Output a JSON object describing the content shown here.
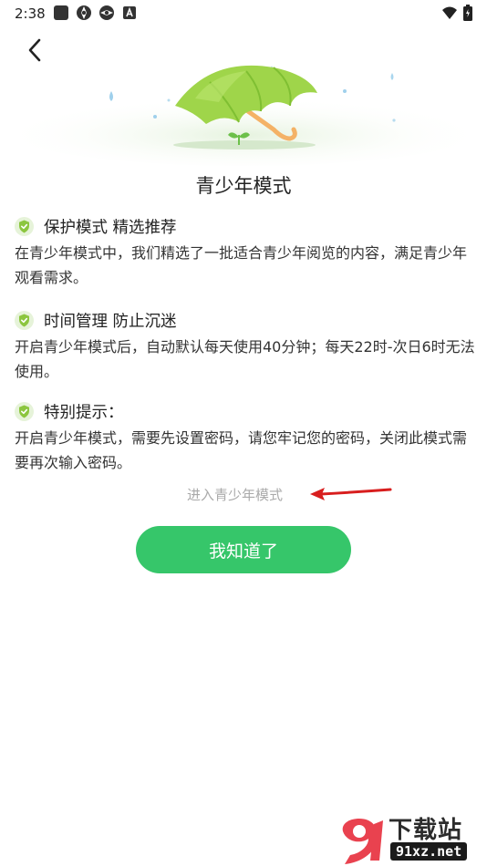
{
  "status_bar": {
    "time": "2:38"
  },
  "header": {
    "back_icon": "chevron-left-icon"
  },
  "page": {
    "title": "青少年模式"
  },
  "sections": [
    {
      "heading": "保护模式 精选推荐",
      "body": "在青少年模式中，我们精选了一批适合青少年阅览的内容，满足青少年观看需求。"
    },
    {
      "heading": "时间管理 防止沉迷",
      "body": "开启青少年模式后，自动默认每天使用40分钟；每天22时-次日6时无法使用。"
    },
    {
      "heading": "特别提示：",
      "body": "开启青少年模式，需要先设置密码，请您牢记您的密码，关闭此模式需要再次输入密码。"
    }
  ],
  "actions": {
    "enter_link": "进入青少年模式",
    "confirm_button": "我知道了"
  },
  "watermark": {
    "title": "下载站",
    "url": "91xz.net"
  },
  "colors": {
    "accent_green": "#36c66a",
    "shield_green": "#8cc63f",
    "annotation_red": "#d81e1e",
    "umbrella_green": "#9fd54a"
  }
}
